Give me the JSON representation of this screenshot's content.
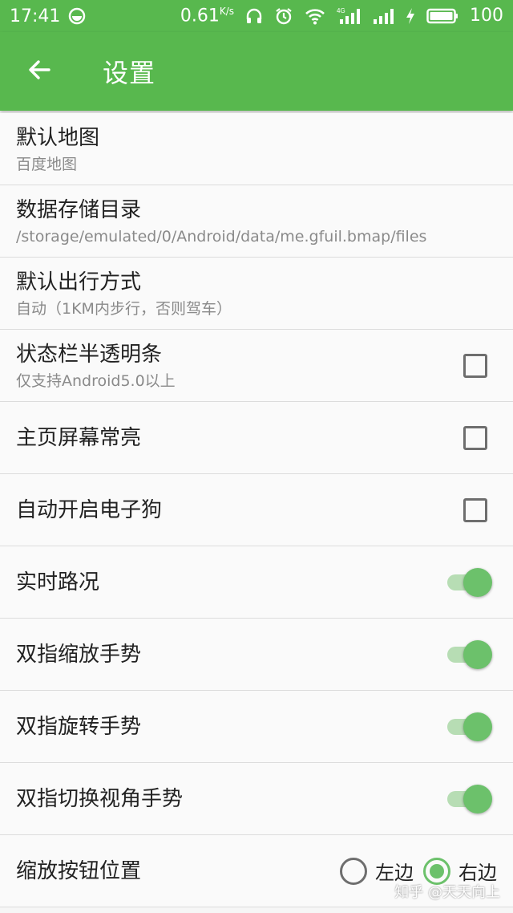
{
  "status_bar": {
    "time": "17:41",
    "speed": "0.61",
    "speed_unit": "K/s",
    "network_label": "4G",
    "battery": "100"
  },
  "app_bar": {
    "title": "设置"
  },
  "settings": [
    {
      "title": "默认地图",
      "subtitle": "百度地图"
    },
    {
      "title": "数据存储目录",
      "subtitle": "/storage/emulated/0/Android/data/me.gfuil.bmap/files"
    },
    {
      "title": "默认出行方式",
      "subtitle": "自动（1KM内步行，否则驾车）"
    },
    {
      "title": "状态栏半透明条",
      "subtitle": "仅支持Android5.0以上",
      "checked": false
    },
    {
      "title": "主页屏幕常亮",
      "checked": false
    },
    {
      "title": "自动开启电子狗",
      "checked": false
    },
    {
      "title": "实时路况",
      "on": true
    },
    {
      "title": "双指缩放手势",
      "on": true
    },
    {
      "title": "双指旋转手势",
      "on": true
    },
    {
      "title": "双指切换视角手势",
      "on": true
    },
    {
      "title": "缩放按钮位置",
      "options": [
        "左边",
        "右边"
      ],
      "selected": "右边"
    }
  ],
  "watermark": "知乎 @天天向上",
  "colors": {
    "primary": "#58b84e",
    "accent": "#6cc16b",
    "switch_track": "#b7ddb4"
  },
  "icons": {
    "back": "arrow-left-icon",
    "alarm": "alarm-clock-icon",
    "headphones": "headphones-icon",
    "wifi": "wifi-icon",
    "signal": "cell-signal-icon",
    "charging": "lightning-icon",
    "battery": "battery-icon"
  }
}
